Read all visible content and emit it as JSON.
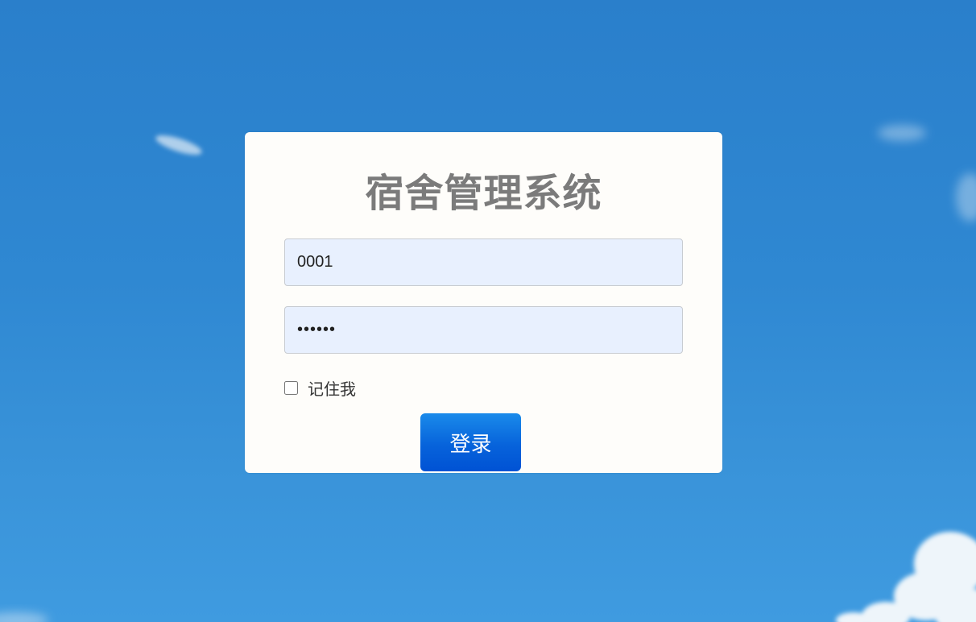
{
  "colors": {
    "sky": "#2f88d2",
    "card": "#fefdfa",
    "title": "#7b7b7b",
    "input_bg": "#e8f0fe",
    "button": "#0763db"
  },
  "login": {
    "title": "宿舍管理系统",
    "username_value": "0001",
    "password_value": "••••••",
    "remember_label": "记住我",
    "remember_checked": false,
    "submit_label": "登录"
  }
}
